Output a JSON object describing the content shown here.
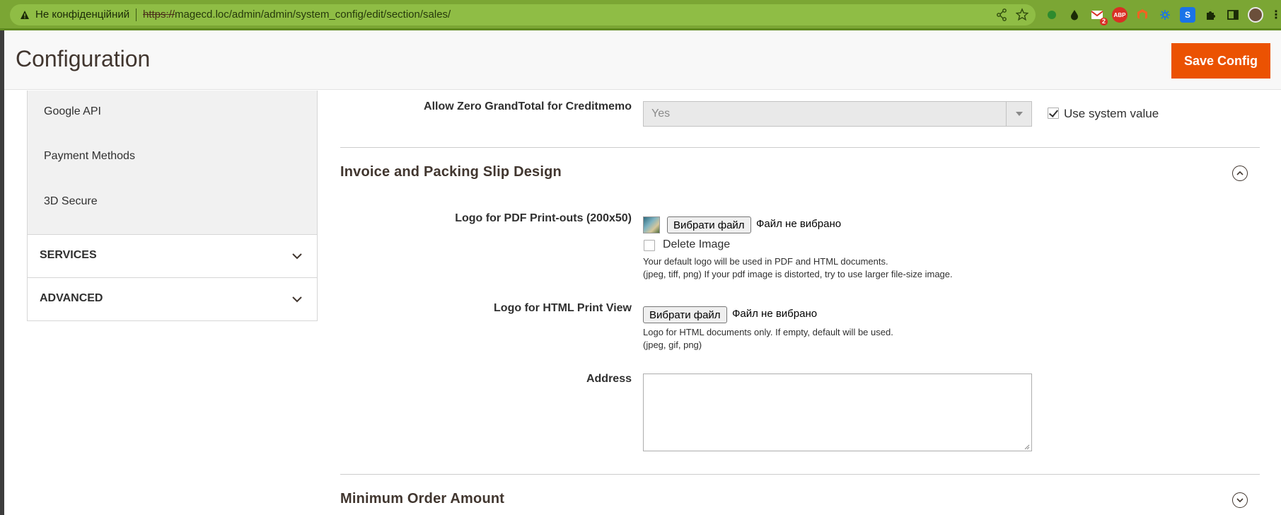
{
  "browser": {
    "security_label": "Не конфіденційний",
    "url_scheme": "https://",
    "url_rest": "magecd.loc/admin/admin/system_config/edit/section/sales/",
    "gmail_badge": "2",
    "abp_label": "ABP",
    "s_ext_label": "S"
  },
  "header": {
    "title": "Configuration",
    "save_label": "Save Config"
  },
  "sidebar": {
    "items": [
      {
        "label": "Google API"
      },
      {
        "label": "Payment Methods"
      },
      {
        "label": "3D Secure"
      }
    ],
    "sections": [
      {
        "label": "SERVICES"
      },
      {
        "label": "ADVANCED"
      }
    ]
  },
  "main": {
    "zero_grandtotal": {
      "label": "Allow Zero GrandTotal for Creditmemo",
      "value": "Yes",
      "use_system_label": "Use system value",
      "use_system_checked": true
    },
    "invoice_section": {
      "title": "Invoice and Packing Slip Design",
      "expanded": true,
      "pdf_logo": {
        "label": "Logo for PDF Print-outs (200x50)",
        "button": "Вибрати файл",
        "status": "Файл не вибрано",
        "delete_label": "Delete Image",
        "note_line1": "Your default logo will be used in PDF and HTML documents.",
        "note_line2": "(jpeg, tiff, png) If your pdf image is distorted, try to use larger file-size image."
      },
      "html_logo": {
        "label": "Logo for HTML Print View",
        "button": "Вибрати файл",
        "status": "Файл не вибрано",
        "note_line1": "Logo for HTML documents only. If empty, default will be used.",
        "note_line2": "(jpeg, gif, png)"
      },
      "address": {
        "label": "Address",
        "value": ""
      }
    },
    "min_order_section": {
      "title": "Minimum Order Amount",
      "expanded": false
    }
  },
  "colors": {
    "brand_orange": "#eb5202",
    "chrome_green": "#7ba634"
  }
}
